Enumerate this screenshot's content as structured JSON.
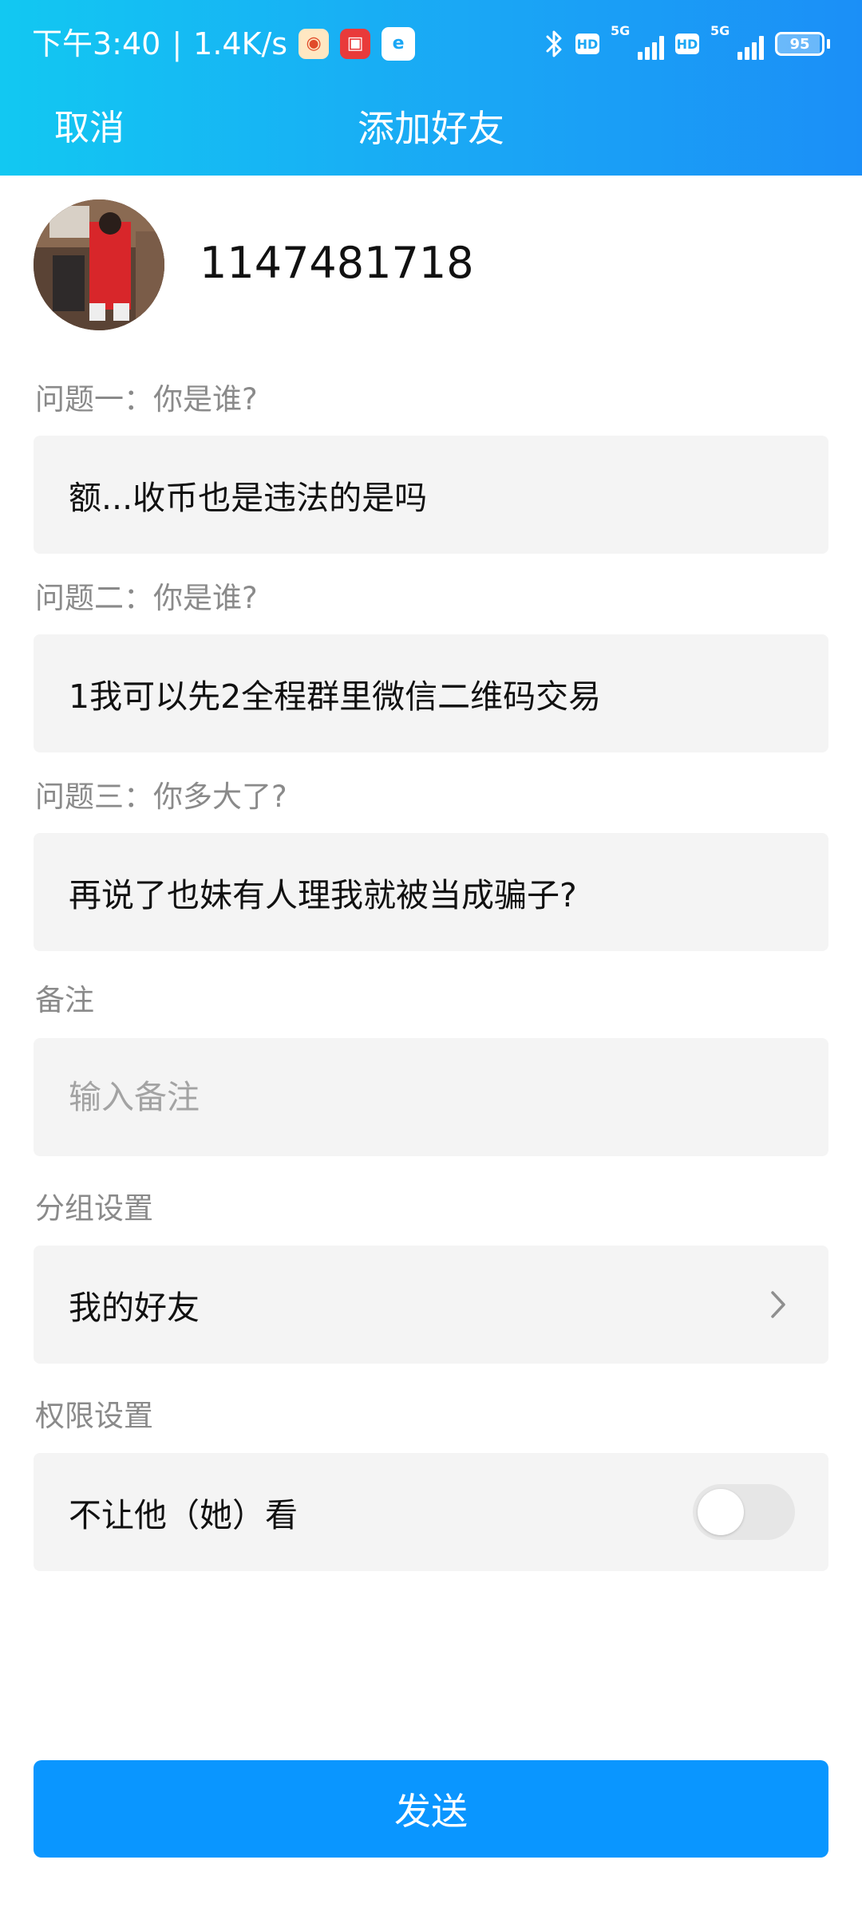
{
  "status_bar": {
    "time": "下午3:40",
    "separator": "|",
    "net_speed": "1.4K/s",
    "hd": "HD",
    "net_type": "5G",
    "battery": "95",
    "battery_level": 0.95,
    "icons": [
      "app-notification-icon",
      "app-notification-icon",
      "app-notification-icon",
      "bluetooth-icon",
      "hd-icon",
      "signal-icon",
      "hd-icon",
      "signal-icon",
      "battery-icon"
    ]
  },
  "nav": {
    "cancel_label": "取消",
    "title": "添加好友"
  },
  "profile": {
    "user_id": "1147481718"
  },
  "questions": [
    {
      "label": "问题一：你是谁?",
      "answer": "额...收币也是违法的是吗"
    },
    {
      "label": "问题二：你是谁?",
      "answer": "1我可以先2全程群里微信二维码交易"
    },
    {
      "label": "问题三：你多大了?",
      "answer": "再说了也妹有人理我就被当成骗子?"
    }
  ],
  "remark": {
    "label": "备注",
    "placeholder": "输入备注",
    "value": ""
  },
  "group": {
    "label": "分组设置",
    "value": "我的好友"
  },
  "permission": {
    "label": "权限设置",
    "option_label": "不让他（她）看",
    "enabled": false
  },
  "send_label": "发送",
  "colors": {
    "header_start": "#12c8f2",
    "header_end": "#1b8ff7",
    "primary_button": "#0a96ff",
    "field_bg": "#f4f4f4",
    "label_gray": "#8a8a8a"
  }
}
